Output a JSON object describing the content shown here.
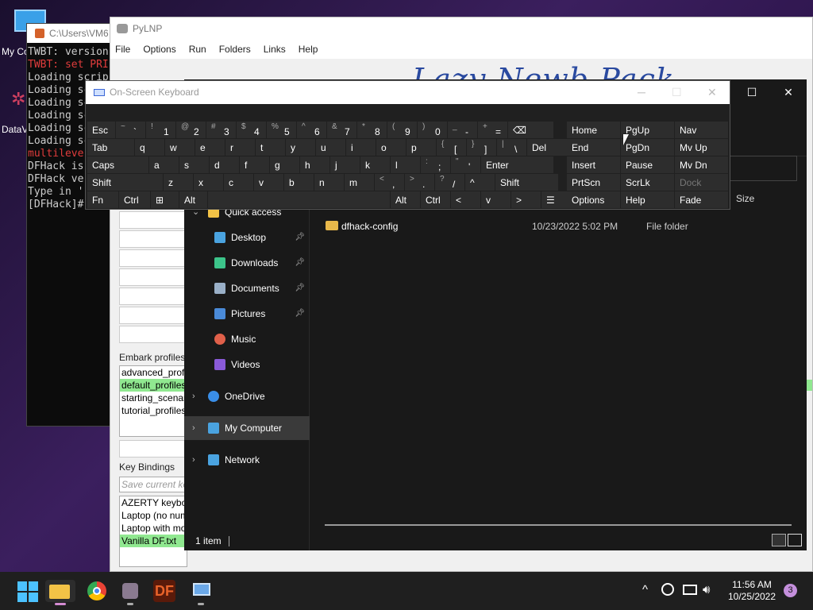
{
  "desktop": {
    "icons": [
      {
        "label": "My Co",
        "icon": "monitor-icon"
      },
      {
        "label": "DataV",
        "icon": "datavis-icon"
      }
    ]
  },
  "console": {
    "title": "C:\\Users\\VM6",
    "lines": [
      {
        "text": "TWBT: version",
        "red": false
      },
      {
        "text": "TWBT: set PRI",
        "red": true
      },
      {
        "text": "Loading scrip",
        "red": false
      },
      {
        "text": "Loading sc",
        "red": false
      },
      {
        "text": "Loading sc",
        "red": false
      },
      {
        "text": "Loading sc",
        "red": false
      },
      {
        "text": "Loading sc",
        "red": false
      },
      {
        "text": "Loading sc",
        "red": false
      },
      {
        "text": "multileve",
        "red": true
      },
      {
        "text": "DFHack is",
        "red": false
      },
      {
        "text": "DFHack ve",
        "red": false
      },
      {
        "text": "Type in '",
        "red": false
      },
      {
        "text": "[DFHack]#",
        "red": false
      }
    ]
  },
  "pylnp": {
    "title": "PyLNP",
    "menu": [
      "File",
      "Options",
      "Run",
      "Folders",
      "Links",
      "Help"
    ],
    "logo": "Lazy Newb Pack",
    "embark_label": "Embark profiles",
    "embark_items": [
      "advanced_profi",
      "default_profiles",
      "starting_scenari",
      "tutorial_profiles"
    ],
    "keybind_label": "Key Bindings",
    "keybind_placeholder": "Save current ke",
    "keybind_items": [
      "AZERTY keyboa",
      "Laptop (no num",
      "Laptop with mo",
      "Vanilla DF.txt"
    ]
  },
  "explorer": {
    "header_size": "Size",
    "nav": [
      {
        "label": "Quick access",
        "icon": "star-icon",
        "level": 0
      },
      {
        "label": "Desktop",
        "icon": "desktop-icon",
        "level": 1,
        "pinned": true
      },
      {
        "label": "Downloads",
        "icon": "download-icon",
        "level": 1,
        "pinned": true
      },
      {
        "label": "Documents",
        "icon": "document-icon",
        "level": 1,
        "pinned": true
      },
      {
        "label": "Pictures",
        "icon": "pictures-icon",
        "level": 1,
        "pinned": true
      },
      {
        "label": "Music",
        "icon": "music-icon",
        "level": 1,
        "pinned": false
      },
      {
        "label": "Videos",
        "icon": "videos-icon",
        "level": 1,
        "pinned": false
      },
      {
        "label": "OneDrive",
        "icon": "cloud-icon",
        "level": 0
      },
      {
        "label": "My Computer",
        "icon": "computer-icon",
        "level": 0,
        "selected": true
      },
      {
        "label": "Network",
        "icon": "network-icon",
        "level": 0
      }
    ],
    "files": [
      {
        "name": "dfhack-config",
        "date": "10/23/2022 5:02 PM",
        "type": "File folder",
        "icon": "folder-icon"
      }
    ],
    "status": "1 item"
  },
  "osk": {
    "title": "On-Screen Keyboard",
    "rows": [
      [
        {
          "k": "Esc"
        },
        {
          "k": "`",
          "s": "~"
        },
        {
          "k": "1",
          "s": "!"
        },
        {
          "k": "2",
          "s": "@"
        },
        {
          "k": "3",
          "s": "#"
        },
        {
          "k": "4",
          "s": "$"
        },
        {
          "k": "5",
          "s": "%"
        },
        {
          "k": "6",
          "s": "^"
        },
        {
          "k": "7",
          "s": "&"
        },
        {
          "k": "8",
          "s": "*"
        },
        {
          "k": "9",
          "s": "("
        },
        {
          "k": "0",
          "s": ")"
        },
        {
          "k": "-",
          "s": "_"
        },
        {
          "k": "=",
          "s": "+"
        },
        {
          "k": "⌫"
        }
      ],
      [
        {
          "k": "Tab"
        },
        {
          "k": "q"
        },
        {
          "k": "w"
        },
        {
          "k": "e"
        },
        {
          "k": "r"
        },
        {
          "k": "t"
        },
        {
          "k": "y"
        },
        {
          "k": "u"
        },
        {
          "k": "i"
        },
        {
          "k": "o"
        },
        {
          "k": "p"
        },
        {
          "k": "[",
          "s": "{"
        },
        {
          "k": "]",
          "s": "}"
        },
        {
          "k": "\\",
          "s": "|"
        },
        {
          "k": "Del"
        }
      ],
      [
        {
          "k": "Caps"
        },
        {
          "k": "a"
        },
        {
          "k": "s"
        },
        {
          "k": "d"
        },
        {
          "k": "f"
        },
        {
          "k": "g"
        },
        {
          "k": "h"
        },
        {
          "k": "j"
        },
        {
          "k": "k"
        },
        {
          "k": "l"
        },
        {
          "k": ";",
          "s": ":"
        },
        {
          "k": "'",
          "s": "\""
        },
        {
          "k": "Enter"
        }
      ],
      [
        {
          "k": "Shift"
        },
        {
          "k": "z"
        },
        {
          "k": "x"
        },
        {
          "k": "c"
        },
        {
          "k": "v"
        },
        {
          "k": "b"
        },
        {
          "k": "n"
        },
        {
          "k": "m"
        },
        {
          "k": ",",
          "s": "<"
        },
        {
          "k": ".",
          "s": ">"
        },
        {
          "k": "/",
          "s": "?"
        },
        {
          "k": "^"
        },
        {
          "k": "Shift"
        }
      ],
      [
        {
          "k": "Fn"
        },
        {
          "k": "Ctrl"
        },
        {
          "k": "⊞"
        },
        {
          "k": "Alt"
        },
        {
          "k": ""
        },
        {
          "k": "Alt"
        },
        {
          "k": "Ctrl"
        },
        {
          "k": "<"
        },
        {
          "k": "v"
        },
        {
          "k": ">"
        },
        {
          "k": "☰"
        }
      ]
    ],
    "nav_keys": [
      [
        "Home",
        "PgUp",
        "Nav"
      ],
      [
        "End",
        "PgDn",
        "Mv Up"
      ],
      [
        "Insert",
        "Pause",
        "Mv Dn"
      ],
      [
        "PrtScn",
        "ScrLk",
        "Dock"
      ],
      [
        "Options",
        "Help",
        "Fade"
      ]
    ]
  },
  "taskbar": {
    "time": "11:56 AM",
    "date": "10/25/2022",
    "notif_count": "3",
    "apps": [
      "windows-start-icon",
      "file-explorer-icon",
      "chrome-icon",
      "pylnp-icon",
      "dwarf-fortress-icon",
      "remote-desktop-icon"
    ]
  }
}
